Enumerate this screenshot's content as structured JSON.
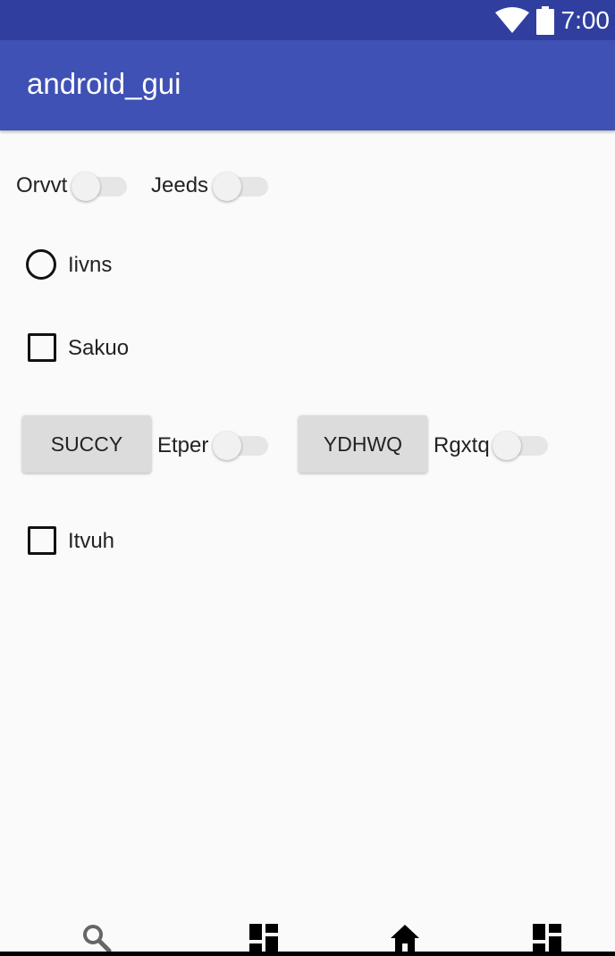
{
  "status_bar": {
    "time": "7:00",
    "icons": [
      "wifi-icon",
      "battery-icon"
    ]
  },
  "app_bar": {
    "title": "android_gui"
  },
  "widgets": {
    "switch_orvvt": {
      "label": "Orvvt",
      "checked": false
    },
    "switch_jeeds": {
      "label": "Jeeds",
      "checked": false
    },
    "radio_iivns": {
      "label": "Iivns",
      "checked": false
    },
    "checkbox_sakuo": {
      "label": "Sakuo",
      "checked": false
    },
    "button_succy": {
      "label": "SUCCY"
    },
    "switch_etper": {
      "label": "Etper",
      "checked": false
    },
    "button_ydhwq": {
      "label": "YDHWQ"
    },
    "switch_rgxtq": {
      "label": "Rgxtq",
      "checked": false
    },
    "checkbox_itvuh": {
      "label": "Itvuh",
      "checked": false
    }
  },
  "bottom_nav": {
    "icons": [
      "search-icon",
      "dashboard-icon",
      "home-icon",
      "dashboard-icon"
    ]
  },
  "colors": {
    "status_bar": "#303f9f",
    "app_bar": "#3f51b5",
    "background": "#fafafa",
    "button": "#dcdcdc"
  }
}
